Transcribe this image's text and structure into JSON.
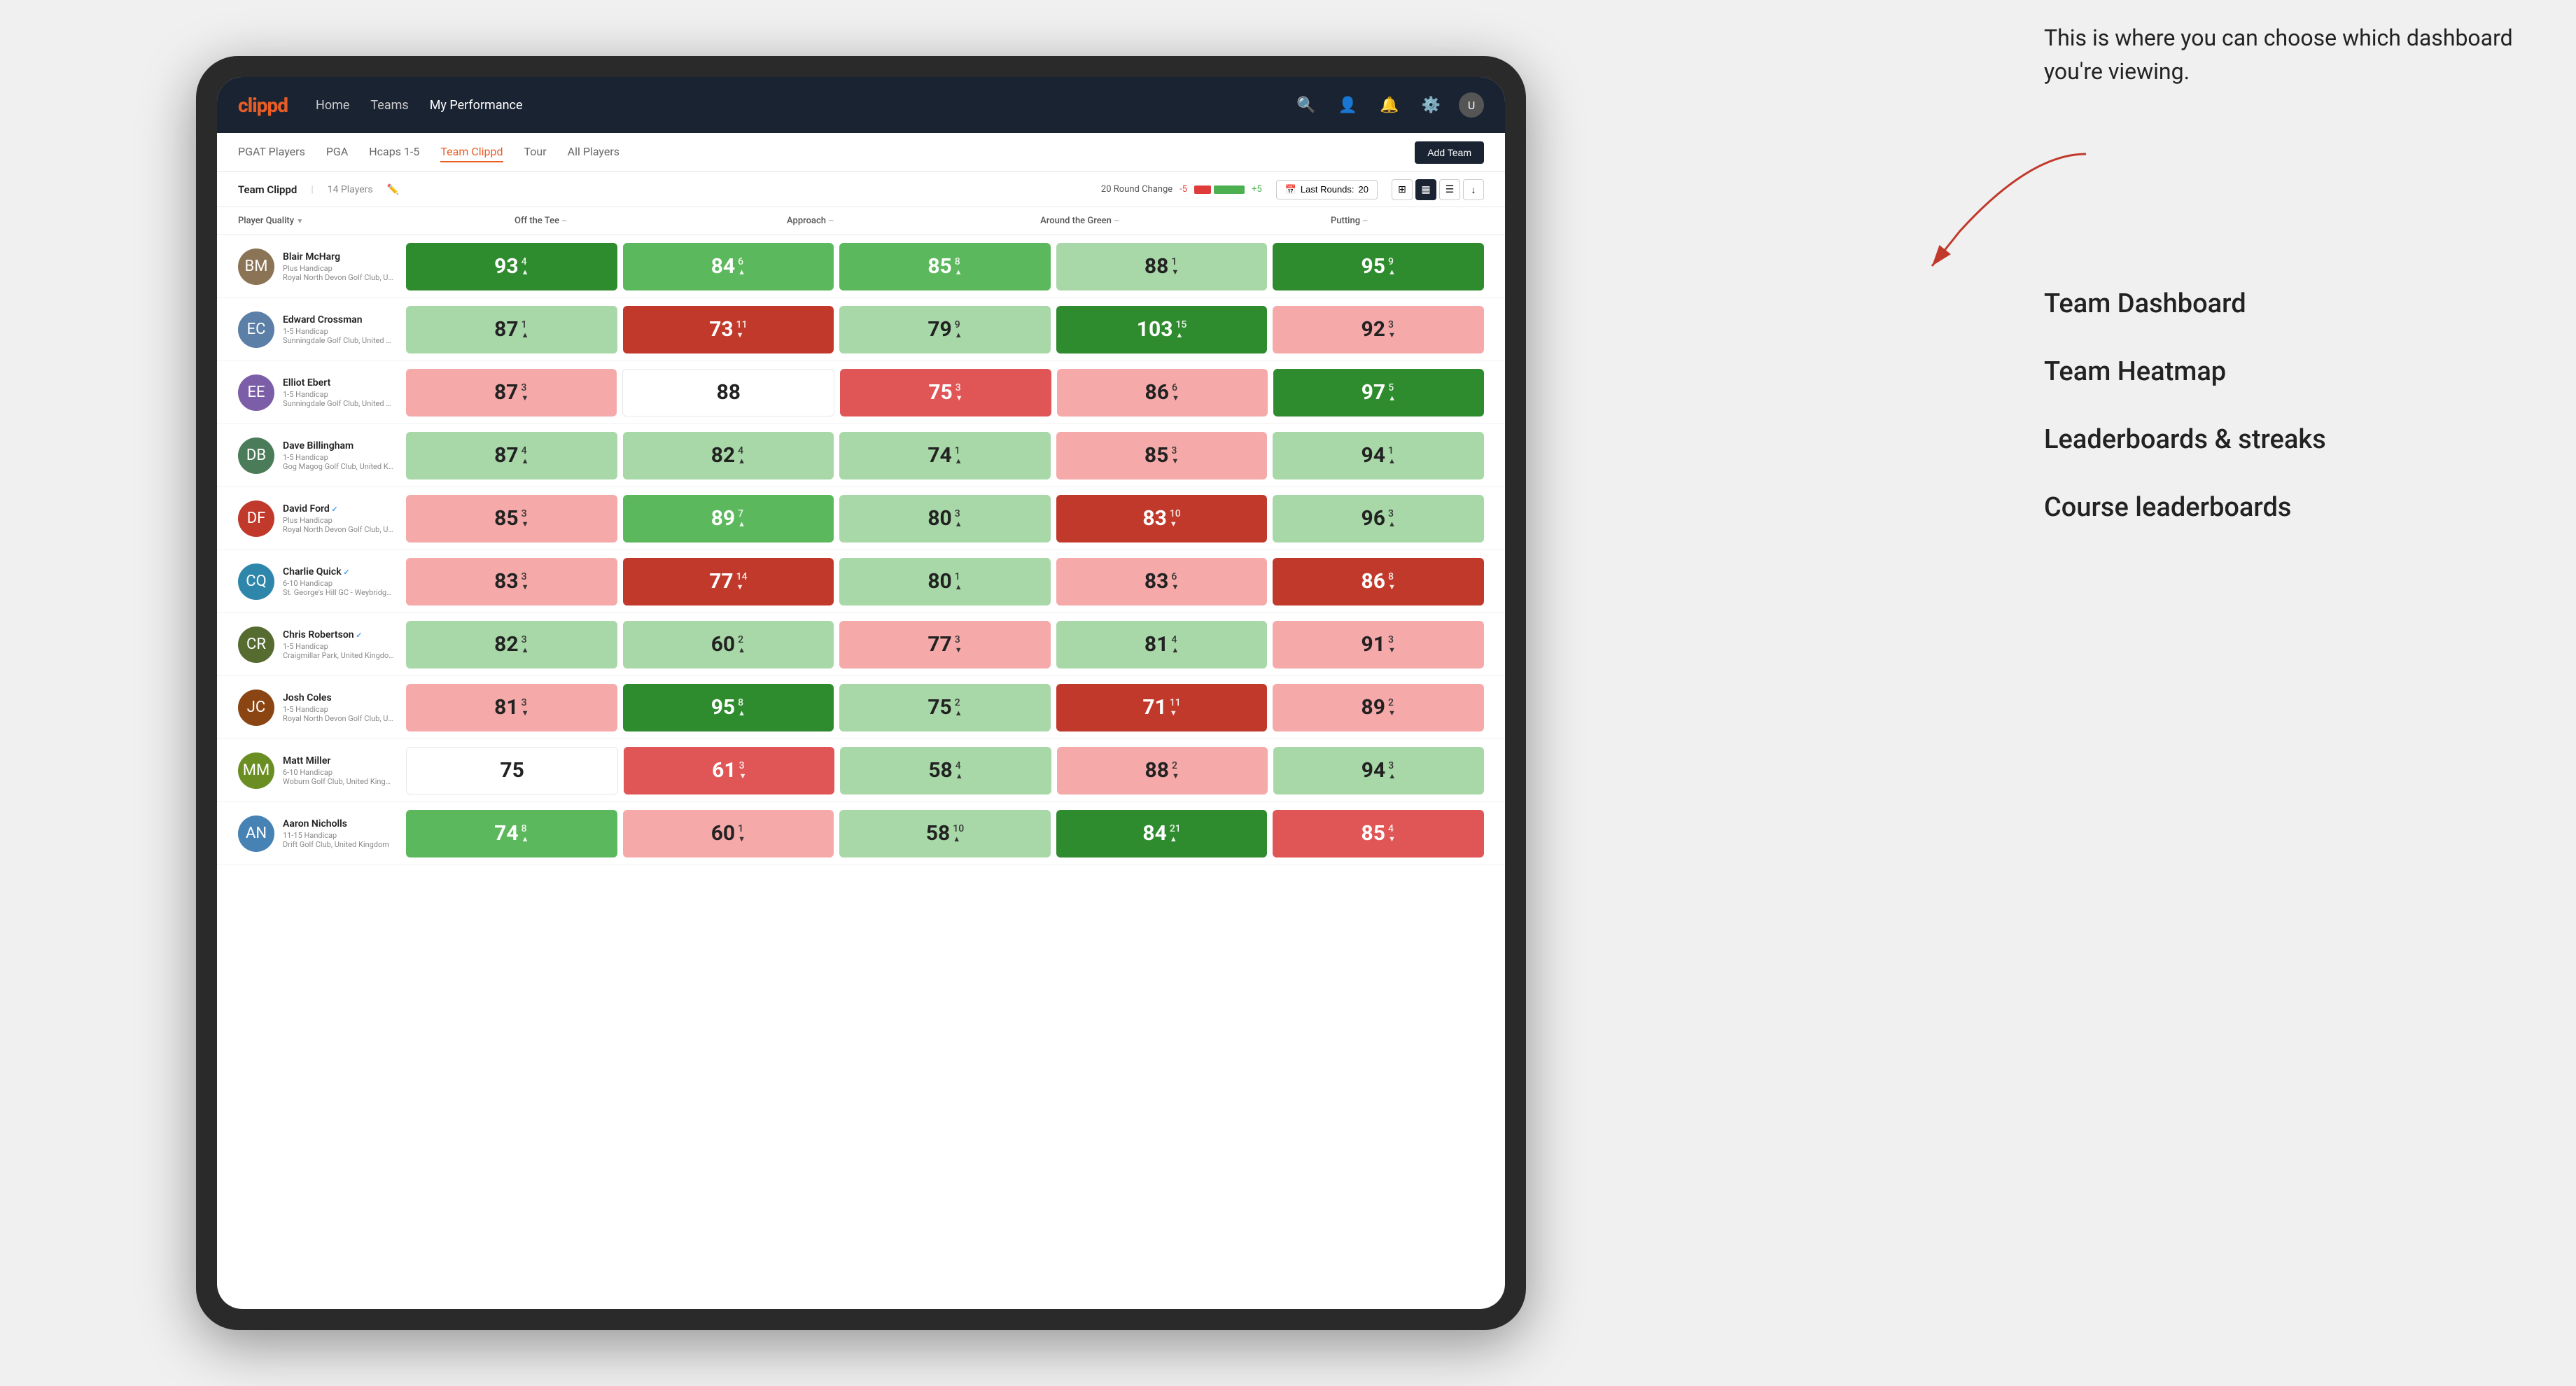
{
  "annotation": {
    "intro_text": "This is where you can choose which dashboard you're viewing.",
    "items": [
      "Team Dashboard",
      "Team Heatmap",
      "Leaderboards & streaks",
      "Course leaderboards"
    ]
  },
  "nav": {
    "logo": "clippd",
    "links": [
      "Home",
      "Teams",
      "My Performance"
    ],
    "active_link": "My Performance"
  },
  "sub_nav": {
    "tabs": [
      "PGAT Players",
      "PGA",
      "Hcaps 1-5",
      "Team Clippd",
      "Tour",
      "All Players"
    ],
    "active_tab": "Team Clippd",
    "add_team_label": "Add Team"
  },
  "team_header": {
    "name": "Team Clippd",
    "separator": "|",
    "count": "14 Players",
    "round_change_label": "20 Round Change",
    "round_change_neg": "-5",
    "round_change_pos": "+5",
    "last_rounds_label": "Last Rounds:",
    "last_rounds_value": "20"
  },
  "columns": {
    "player": "Player Quality",
    "off_tee": "Off the Tee",
    "approach": "Approach",
    "around_green": "Around the Green",
    "putting": "Putting"
  },
  "players": [
    {
      "name": "Blair McHarg",
      "handicap": "Plus Handicap",
      "club": "Royal North Devon Golf Club, United Kingdom",
      "avatar_color": "#8B7355",
      "initials": "BM",
      "stats": [
        {
          "value": 93,
          "change": 4,
          "direction": "up",
          "color": "green-dark"
        },
        {
          "value": 84,
          "change": 6,
          "direction": "up",
          "color": "green-med"
        },
        {
          "value": 85,
          "change": 8,
          "direction": "up",
          "color": "green-med"
        },
        {
          "value": 88,
          "change": 1,
          "direction": "down",
          "color": "green-light"
        },
        {
          "value": 95,
          "change": 9,
          "direction": "up",
          "color": "green-dark"
        }
      ]
    },
    {
      "name": "Edward Crossman",
      "handicap": "1-5 Handicap",
      "club": "Sunningdale Golf Club, United Kingdom",
      "avatar_color": "#5B7FA6",
      "initials": "EC",
      "stats": [
        {
          "value": 87,
          "change": 1,
          "direction": "up",
          "color": "green-light"
        },
        {
          "value": 73,
          "change": 11,
          "direction": "down",
          "color": "red-dark"
        },
        {
          "value": 79,
          "change": 9,
          "direction": "up",
          "color": "green-light"
        },
        {
          "value": 103,
          "change": 15,
          "direction": "up",
          "color": "green-dark"
        },
        {
          "value": 92,
          "change": 3,
          "direction": "down",
          "color": "red-light"
        }
      ]
    },
    {
      "name": "Elliot Ebert",
      "handicap": "1-5 Handicap",
      "club": "Sunningdale Golf Club, United Kingdom",
      "avatar_color": "#7B5EA7",
      "initials": "EE",
      "stats": [
        {
          "value": 87,
          "change": 3,
          "direction": "down",
          "color": "red-light"
        },
        {
          "value": 88,
          "change": null,
          "direction": null,
          "color": "neutral"
        },
        {
          "value": 75,
          "change": 3,
          "direction": "down",
          "color": "red-med"
        },
        {
          "value": 86,
          "change": 6,
          "direction": "down",
          "color": "red-light"
        },
        {
          "value": 97,
          "change": 5,
          "direction": "up",
          "color": "green-dark"
        }
      ]
    },
    {
      "name": "Dave Billingham",
      "handicap": "1-5 Handicap",
      "club": "Gog Magog Golf Club, United Kingdom",
      "avatar_color": "#4A7C59",
      "initials": "DB",
      "stats": [
        {
          "value": 87,
          "change": 4,
          "direction": "up",
          "color": "green-light"
        },
        {
          "value": 82,
          "change": 4,
          "direction": "up",
          "color": "green-light"
        },
        {
          "value": 74,
          "change": 1,
          "direction": "up",
          "color": "green-light"
        },
        {
          "value": 85,
          "change": 3,
          "direction": "down",
          "color": "red-light"
        },
        {
          "value": 94,
          "change": 1,
          "direction": "up",
          "color": "green-light"
        }
      ]
    },
    {
      "name": "David Ford",
      "handicap": "Plus Handicap",
      "club": "Royal North Devon Golf Club, United Kingdom",
      "avatar_color": "#C0392B",
      "initials": "DF",
      "verified": true,
      "stats": [
        {
          "value": 85,
          "change": 3,
          "direction": "down",
          "color": "red-light"
        },
        {
          "value": 89,
          "change": 7,
          "direction": "up",
          "color": "green-med"
        },
        {
          "value": 80,
          "change": 3,
          "direction": "up",
          "color": "green-light"
        },
        {
          "value": 83,
          "change": 10,
          "direction": "down",
          "color": "red-dark"
        },
        {
          "value": 96,
          "change": 3,
          "direction": "up",
          "color": "green-light"
        }
      ]
    },
    {
      "name": "Charlie Quick",
      "handicap": "6-10 Handicap",
      "club": "St. George's Hill GC - Weybridge - Surrey, Uni...",
      "avatar_color": "#2E86AB",
      "initials": "CQ",
      "verified": true,
      "stats": [
        {
          "value": 83,
          "change": 3,
          "direction": "down",
          "color": "red-light"
        },
        {
          "value": 77,
          "change": 14,
          "direction": "down",
          "color": "red-dark"
        },
        {
          "value": 80,
          "change": 1,
          "direction": "up",
          "color": "green-light"
        },
        {
          "value": 83,
          "change": 6,
          "direction": "down",
          "color": "red-light"
        },
        {
          "value": 86,
          "change": 8,
          "direction": "down",
          "color": "red-dark"
        }
      ]
    },
    {
      "name": "Chris Robertson",
      "handicap": "1-5 Handicap",
      "club": "Craigmillar Park, United Kingdom",
      "avatar_color": "#556B2F",
      "initials": "CR",
      "verified": true,
      "stats": [
        {
          "value": 82,
          "change": 3,
          "direction": "up",
          "color": "green-light"
        },
        {
          "value": 60,
          "change": 2,
          "direction": "up",
          "color": "green-light"
        },
        {
          "value": 77,
          "change": 3,
          "direction": "down",
          "color": "red-light"
        },
        {
          "value": 81,
          "change": 4,
          "direction": "up",
          "color": "green-light"
        },
        {
          "value": 91,
          "change": 3,
          "direction": "down",
          "color": "red-light"
        }
      ]
    },
    {
      "name": "Josh Coles",
      "handicap": "1-5 Handicap",
      "club": "Royal North Devon Golf Club, United Kingdom",
      "avatar_color": "#8B4513",
      "initials": "JC",
      "stats": [
        {
          "value": 81,
          "change": 3,
          "direction": "down",
          "color": "red-light"
        },
        {
          "value": 95,
          "change": 8,
          "direction": "up",
          "color": "green-dark"
        },
        {
          "value": 75,
          "change": 2,
          "direction": "up",
          "color": "green-light"
        },
        {
          "value": 71,
          "change": 11,
          "direction": "down",
          "color": "red-dark"
        },
        {
          "value": 89,
          "change": 2,
          "direction": "down",
          "color": "red-light"
        }
      ]
    },
    {
      "name": "Matt Miller",
      "handicap": "6-10 Handicap",
      "club": "Woburn Golf Club, United Kingdom",
      "avatar_color": "#6B8E23",
      "initials": "MM",
      "stats": [
        {
          "value": 75,
          "change": null,
          "direction": null,
          "color": "neutral"
        },
        {
          "value": 61,
          "change": 3,
          "direction": "down",
          "color": "red-med"
        },
        {
          "value": 58,
          "change": 4,
          "direction": "up",
          "color": "green-light"
        },
        {
          "value": 88,
          "change": 2,
          "direction": "down",
          "color": "red-light"
        },
        {
          "value": 94,
          "change": 3,
          "direction": "up",
          "color": "green-light"
        }
      ]
    },
    {
      "name": "Aaron Nicholls",
      "handicap": "11-15 Handicap",
      "club": "Drift Golf Club, United Kingdom",
      "avatar_color": "#4682B4",
      "initials": "AN",
      "stats": [
        {
          "value": 74,
          "change": 8,
          "direction": "up",
          "color": "green-med"
        },
        {
          "value": 60,
          "change": 1,
          "direction": "down",
          "color": "red-light"
        },
        {
          "value": 58,
          "change": 10,
          "direction": "up",
          "color": "green-light"
        },
        {
          "value": 84,
          "change": 21,
          "direction": "up",
          "color": "green-dark"
        },
        {
          "value": 85,
          "change": 4,
          "direction": "down",
          "color": "red-med"
        }
      ]
    }
  ]
}
